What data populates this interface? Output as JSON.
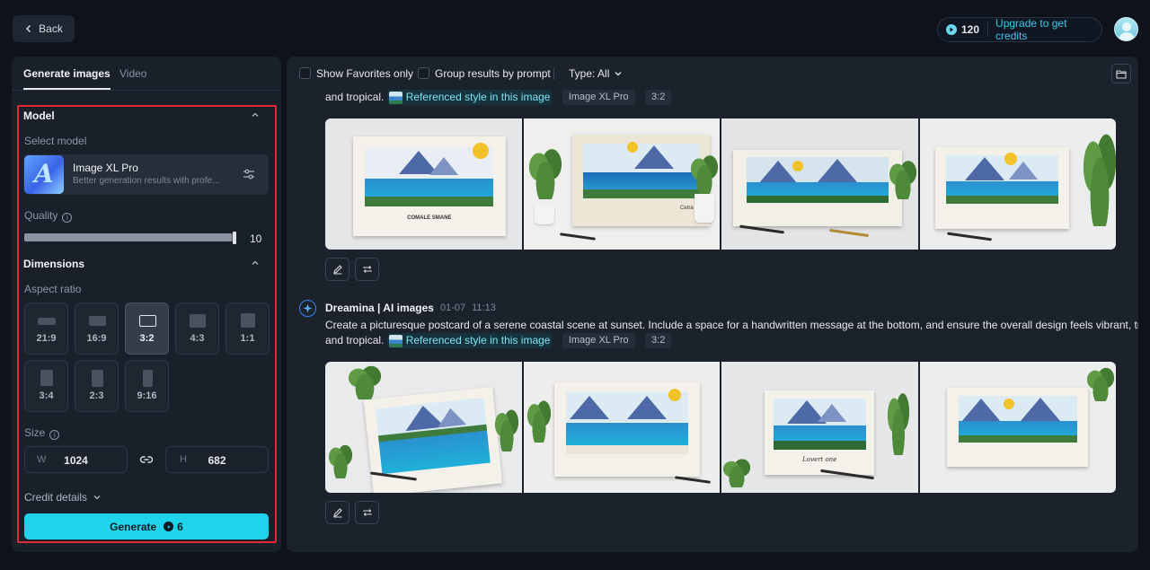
{
  "header": {
    "back_label": "Back",
    "credits": "120",
    "upgrade_label": "Upgrade to get credits"
  },
  "left": {
    "tabs": [
      "Generate images",
      "Video"
    ],
    "model": {
      "section_title": "Model",
      "select_label": "Select model",
      "name": "Image XL Pro",
      "description": "Better generation results with profe..."
    },
    "quality": {
      "label": "Quality",
      "value": "10",
      "fill_fraction": 0.98
    },
    "dimensions": {
      "section_title": "Dimensions",
      "aspect_label": "Aspect ratio",
      "ratios": [
        "21:9",
        "16:9",
        "3:2",
        "4:3",
        "1:1",
        "3:4",
        "2:3",
        "9:16"
      ],
      "selected": "3:2"
    },
    "size": {
      "label": "Size",
      "w_key": "W",
      "w_value": "1024",
      "h_key": "H",
      "h_value": "682"
    },
    "credit_details": "Credit details",
    "generate_label": "Generate",
    "generate_cost": "6"
  },
  "filters": {
    "show_favorites": "Show Favorites only",
    "group_by_prompt": "Group results by prompt",
    "type_label": "Type: All"
  },
  "feed": {
    "first": {
      "prompt_tail": "and tropical.",
      "ref_label": "Referenced style in this image",
      "model_tag": "Image XL Pro",
      "ratio_tag": "3:2",
      "card_texts": [
        "COMALE SMANE",
        "Cetra"
      ]
    },
    "second": {
      "author": "Dreamina | AI images",
      "date": "01-07",
      "time": "11:13",
      "prompt_line1": "Create a picturesque postcard of a serene coastal scene at sunset. Include a space for a handwritten message at the bottom, and ensure the overall design feels vibrant, tranquil,",
      "prompt_tail": "and tropical.",
      "ref_label": "Referenced style in this image",
      "model_tag": "Image XL Pro",
      "ratio_tag": "3:2",
      "card_texts": [
        "Lovert one"
      ]
    }
  },
  "colors": {
    "accent": "#1ed3ea",
    "highlight_border": "#e02a34",
    "link": "#38c8e8"
  }
}
